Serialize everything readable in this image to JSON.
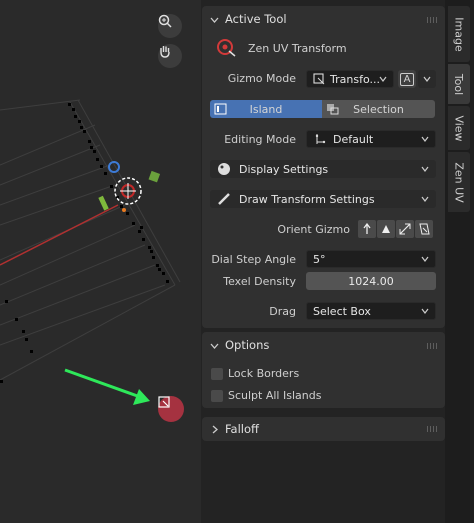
{
  "active_tool": {
    "header": "Active Tool",
    "tool_name": "Zen UV Transform",
    "gizmo_mode_label": "Gizmo Mode",
    "gizmo_mode_value": "Transfo...",
    "gizmo_badge": "A",
    "mode_island": "Island",
    "mode_selection": "Selection",
    "editing_mode_label": "Editing Mode",
    "editing_mode_value": "Default",
    "display_settings": "Display Settings",
    "draw_transform_settings": "Draw Transform Settings",
    "orient_gizmo_label": "Orient Gizmo",
    "dial_step_label": "Dial Step Angle",
    "dial_step_value": "5°",
    "texel_density_label": "Texel Density",
    "texel_density_value": "1024.00",
    "drag_label": "Drag",
    "drag_value": "Select Box"
  },
  "options": {
    "header": "Options",
    "lock_borders": "Lock Borders",
    "sculpt_all_islands": "Sculpt All Islands"
  },
  "falloff": {
    "header": "Falloff"
  },
  "tabs": [
    "Image",
    "Tool",
    "View",
    "Zen UV"
  ],
  "colors": {
    "accent": "#4772b3",
    "badge_red": "#a53240",
    "arrow_green": "#2ee85a"
  }
}
